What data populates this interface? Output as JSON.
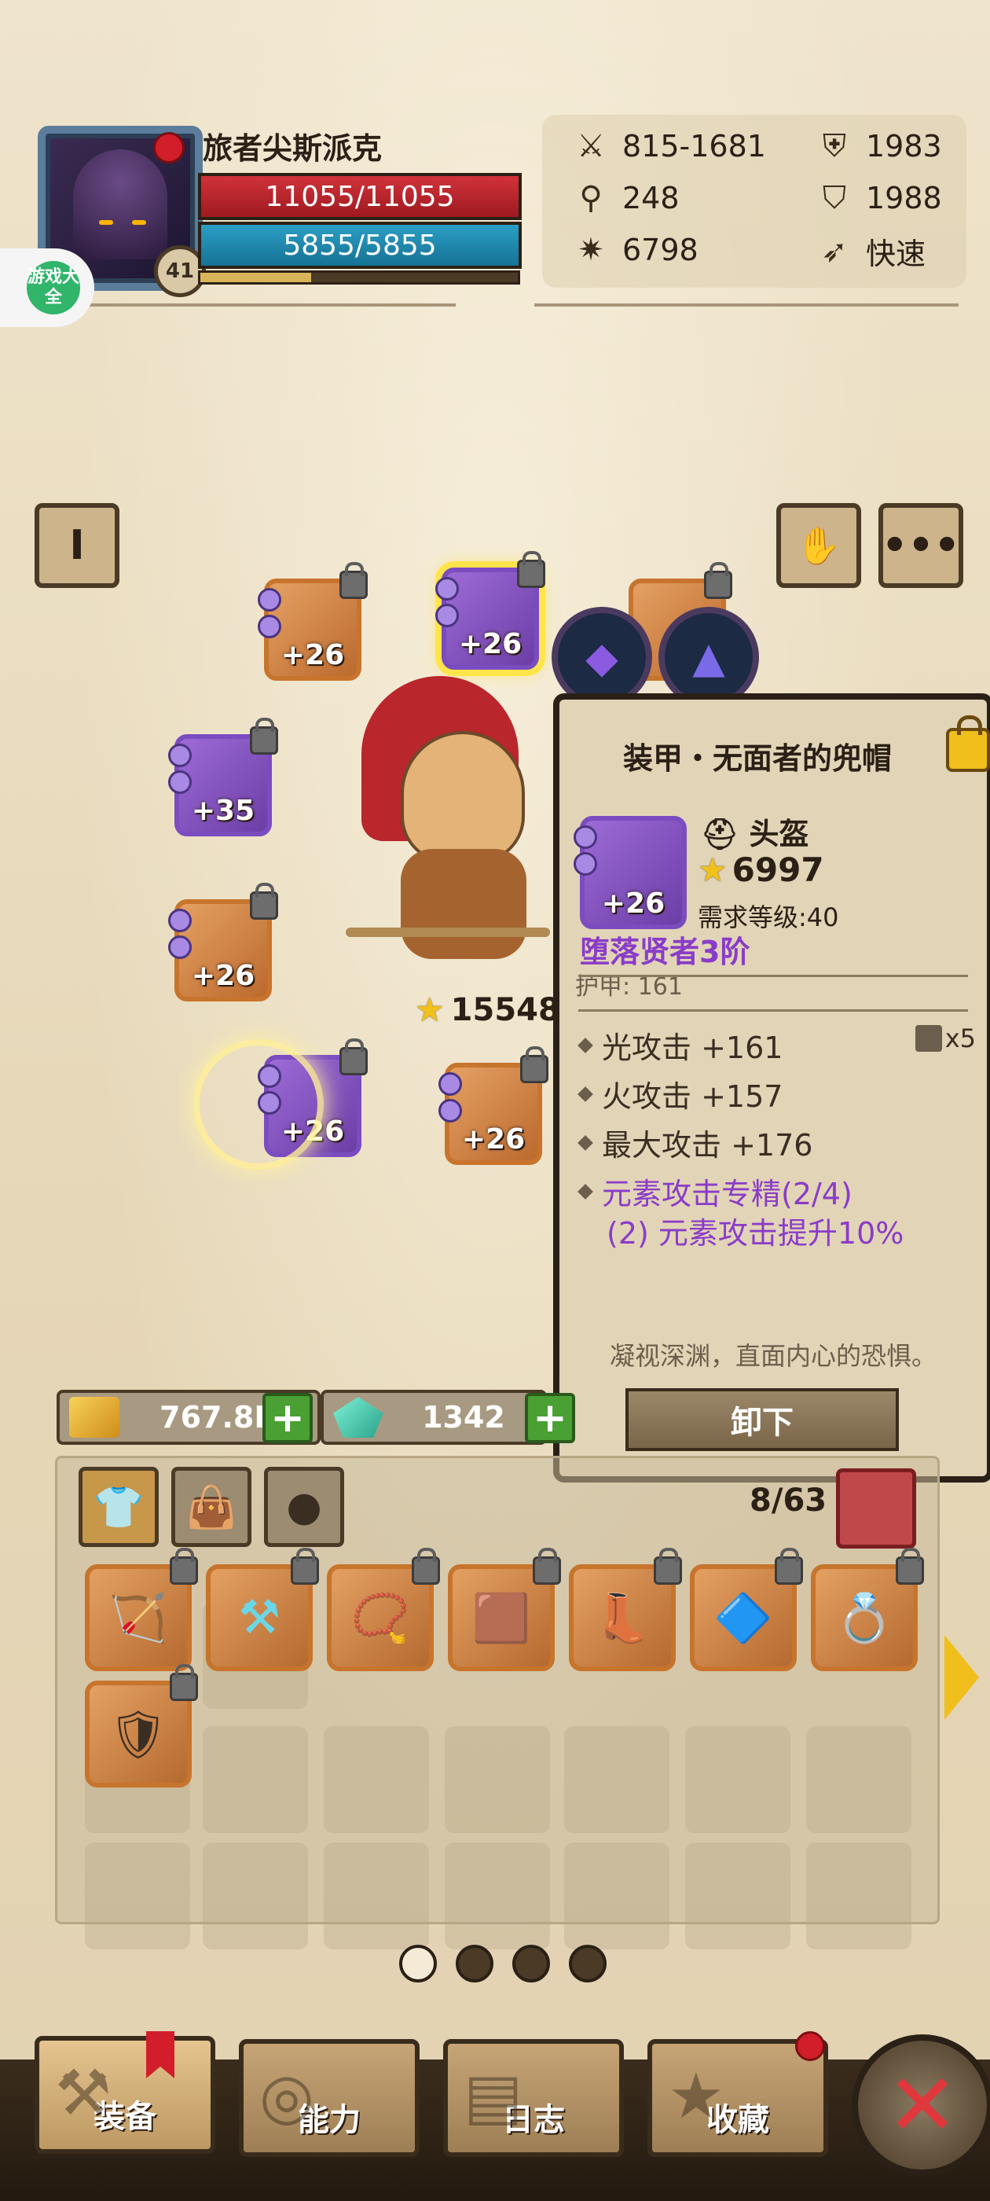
{
  "player": {
    "name": "旅者尖斯派克",
    "level": "41",
    "hp": "11055/11055",
    "mp": "5855/5855",
    "xp_fraction": 0.35
  },
  "stats": [
    {
      "icon": "crossed-swords-icon",
      "value": "815-1681"
    },
    {
      "icon": "armor-icon",
      "value": "1983"
    },
    {
      "icon": "mace-icon",
      "value": "248"
    },
    {
      "icon": "shield-icon",
      "value": "1988"
    },
    {
      "icon": "spark-icon",
      "value": "6798"
    },
    {
      "icon": "boot-speed-icon",
      "value": "快速"
    }
  ],
  "side_logo": "游戏大全",
  "hero_power": "15548",
  "equip_slots": [
    {
      "name": "slot-weapon",
      "plus": "+26"
    },
    {
      "name": "slot-helmet",
      "plus": "+26"
    },
    {
      "name": "slot-amulet",
      "plus": ""
    },
    {
      "name": "slot-cloak",
      "plus": "+35"
    },
    {
      "name": "slot-shoulders",
      "plus": "+26"
    },
    {
      "name": "slot-ring",
      "plus": "+26"
    },
    {
      "name": "slot-gloves",
      "plus": "+26"
    }
  ],
  "tooltip": {
    "title": "装甲・无面者的兜帽",
    "slot_type": "头盔",
    "power": "6997",
    "requirement": "需求等级:40",
    "set_name": "堕落贤者3阶",
    "cut_text": "护甲: 161",
    "attributes": [
      {
        "text": "光攻击 +161",
        "purple": false
      },
      {
        "text": "火攻击 +157",
        "purple": false
      },
      {
        "text": "最大攻击 +176",
        "purple": false
      },
      {
        "text": "元素攻击专精(2/4)",
        "purple": true
      }
    ],
    "set_bonus": "(2) 元素攻击提升10%",
    "forge_count": "x5",
    "flavor": "凝视深渊，直面内心的恐惧。",
    "unequip": "卸下",
    "icon_plus": "+26"
  },
  "currency": {
    "gold": "767.8K",
    "crystal": "1342"
  },
  "inventory": {
    "count": "8/63",
    "tabs": [
      "armor-tab-icon",
      "bag-tab-icon",
      "stone-tab-icon"
    ]
  },
  "bottom_nav": [
    {
      "label": "装备",
      "active": true
    },
    {
      "label": "能力",
      "active": false
    },
    {
      "label": "日志",
      "active": false
    },
    {
      "label": "收藏",
      "active": false
    }
  ],
  "colors": {
    "hp": "#d2323a",
    "mp": "#2b9ec4",
    "set_purple": "#8a3cc8",
    "selected_glow": "#ffe44a"
  }
}
